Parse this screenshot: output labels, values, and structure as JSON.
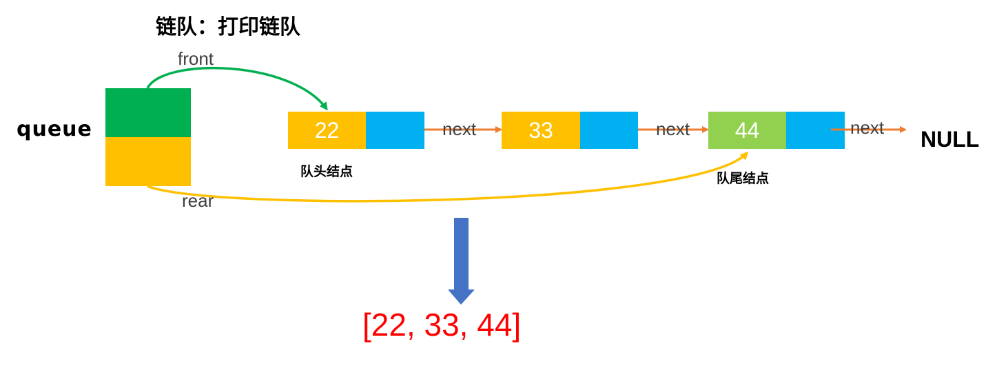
{
  "title": "链队：打印链队",
  "queue_label": "queue",
  "front_label": "front",
  "rear_label": "rear",
  "nodes": [
    {
      "value": "22",
      "next_label": "next",
      "caption": "队头结点"
    },
    {
      "value": "33",
      "next_label": "next"
    },
    {
      "value": "44",
      "next_label": "next",
      "caption": "队尾结点"
    }
  ],
  "null_label": "NULL",
  "output": "[22, 33, 44]",
  "colors": {
    "front_pointer": "#00b050",
    "rear_pointer": "#ffc000",
    "node_data": "#ffc000",
    "tail_node_data": "#92d050",
    "node_next": "#00b0f0",
    "next_arrow": "#ed7d31",
    "down_arrow": "#4472c4",
    "output_text": "#ff0000"
  }
}
